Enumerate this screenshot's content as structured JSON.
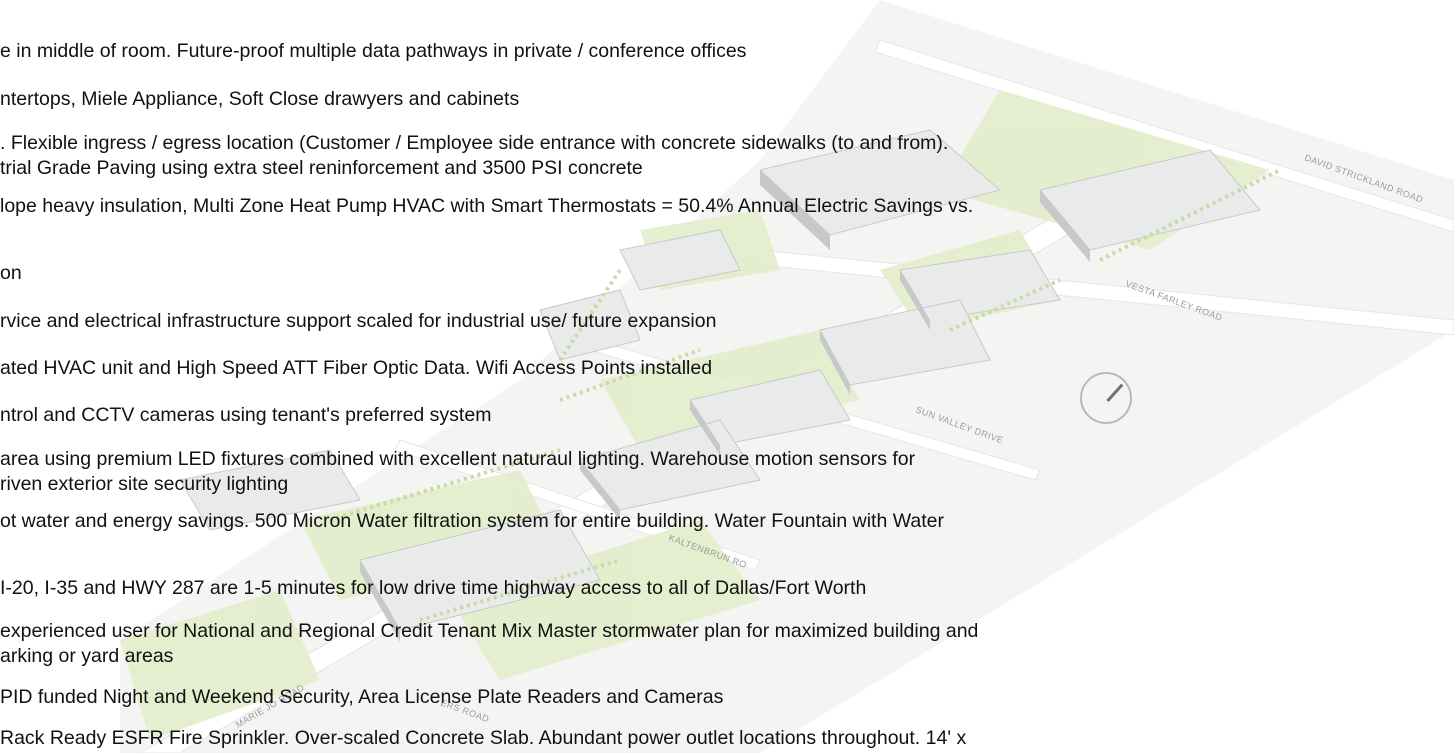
{
  "roads": {
    "david_strickland": "DAVID STRICKLAND ROAD",
    "vesta_farley": "VESTA FARLEY ROAD",
    "sun_valley": "SUN VALLEY DRIVE",
    "kaltenbrun": "KALTENBRUN RO",
    "marie_jones": "MARIE JO    ROAD",
    "ers_road": "ERS ROAD"
  },
  "lines": [
    "e in middle of room. Future-proof multiple data pathways in private / conference offices",
    "ntertops, Miele Appliance, Soft Close drawyers and cabinets",
    ". Flexible ingress / egress location (Customer / Employee side entrance with concrete sidewalks (to and from).",
    "trial Grade Paving using extra steel reninforcement and 3500 PSI concrete",
    "lope heavy insulation, Multi Zone Heat Pump HVAC with Smart Thermostats = 50.4% Annual Electric Savings vs.",
    "on",
    "rvice and electrical infrastructure support scaled for industrial use/ future expansion",
    "ated HVAC unit and High Speed ATT Fiber Optic Data. Wifi Access Points installed",
    "ntrol and CCTV cameras using tenant's preferred system",
    "area using premium LED fixtures combined with excellent naturaul lighting.  Warehouse motion sensors for",
    "riven exterior site security lighting",
    "ot water  and energy savings. 500 Micron Water filtration system for entire building. Water Fountain with Water",
    "I-20, I-35 and HWY 287 are 1-5 minutes for low drive time highway access to all of Dallas/Fort Worth",
    "experienced user for  National and Regional Credit Tenant Mix Master stormwater plan for maximized building and",
    "arking or yard areas",
    "PID funded Night and Weekend Security, Area License Plate Readers and Cameras",
    " Rack Ready ESFR Fire Sprinkler. Over-scaled Concrete Slab.   Abundant power outlet locations throughout. 14' x"
  ]
}
